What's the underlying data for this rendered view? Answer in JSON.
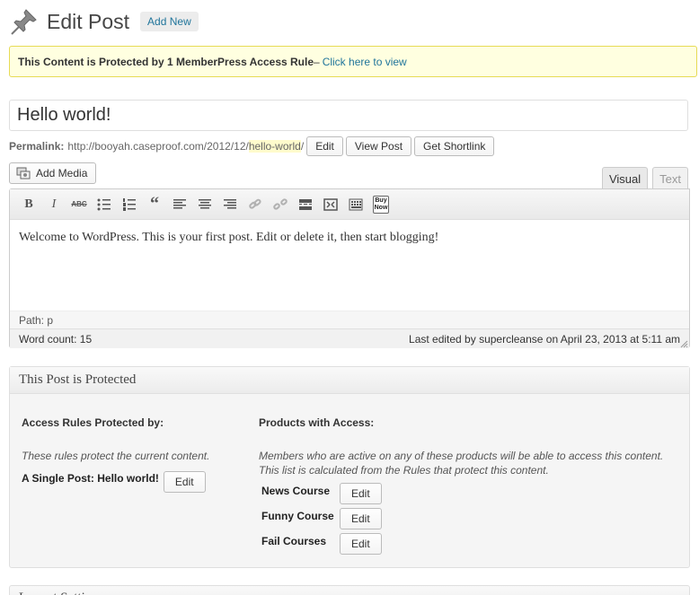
{
  "header": {
    "title": "Edit Post",
    "add_new_label": "Add New"
  },
  "notice": {
    "bold_text": "This Content is Protected by 1 MemberPress Access Rule",
    "dash": " –",
    "link_text": "Click here to view"
  },
  "post": {
    "title_value": "Hello world!",
    "permalink_label": "Permalink:",
    "permalink_base": "http://booyah.caseproof.com/2012/12/",
    "permalink_slug": "hello-world",
    "permalink_end": "/",
    "edit_label": "Edit",
    "view_post_label": "View Post",
    "shortlink_label": "Get Shortlink"
  },
  "editor": {
    "add_media_label": "Add Media",
    "tabs": [
      {
        "label": "Visual"
      },
      {
        "label": "Text"
      }
    ],
    "toolbar": [
      "bold-icon",
      "italic-icon",
      "strikethrough-icon",
      "bullet-list-icon",
      "numbered-list-icon",
      "blockquote-icon",
      "align-left-icon",
      "align-center-icon",
      "align-right-icon",
      "link-icon",
      "unlink-icon",
      "more-tag-icon",
      "fullscreen-icon",
      "kitchen-sink-icon",
      "buy-now-icon"
    ],
    "bold_glyph": "B",
    "italic_glyph": "I",
    "strike_glyph": "ABC",
    "quote_glyph": "“",
    "buy_now_glyph_1": "Buy",
    "buy_now_glyph_2": "Now",
    "content": "Welcome to WordPress. This is your first post. Edit or delete it, then start blogging!",
    "path": "Path: p",
    "word_count": "Word count: 15",
    "last_edited": "Last edited by supercleanse on April 23, 2013 at 5:11 am"
  },
  "protection": {
    "title": "This Post is Protected",
    "rules_heading": "Access Rules Protected by:",
    "rules_desc": "These rules protect the current content.",
    "rules": [
      {
        "name": "A Single Post: Hello world!",
        "edit_label": "Edit"
      }
    ],
    "products_heading": "Products with Access:",
    "products_desc_1": "Members who are active on any of these products will be able to access this content.",
    "products_desc_2": "This list is calculated from the Rules that protect this content.",
    "products": [
      {
        "name": "News Course",
        "edit_label": "Edit"
      },
      {
        "name": "Funny Course",
        "edit_label": "Edit"
      },
      {
        "name": "Fail Courses",
        "edit_label": "Edit"
      }
    ]
  },
  "layout_box": {
    "title": "Layout Setti"
  },
  "colors": {
    "link": "#21759b",
    "notice_bg": "#ffffe0",
    "notice_border": "#e6db55"
  }
}
